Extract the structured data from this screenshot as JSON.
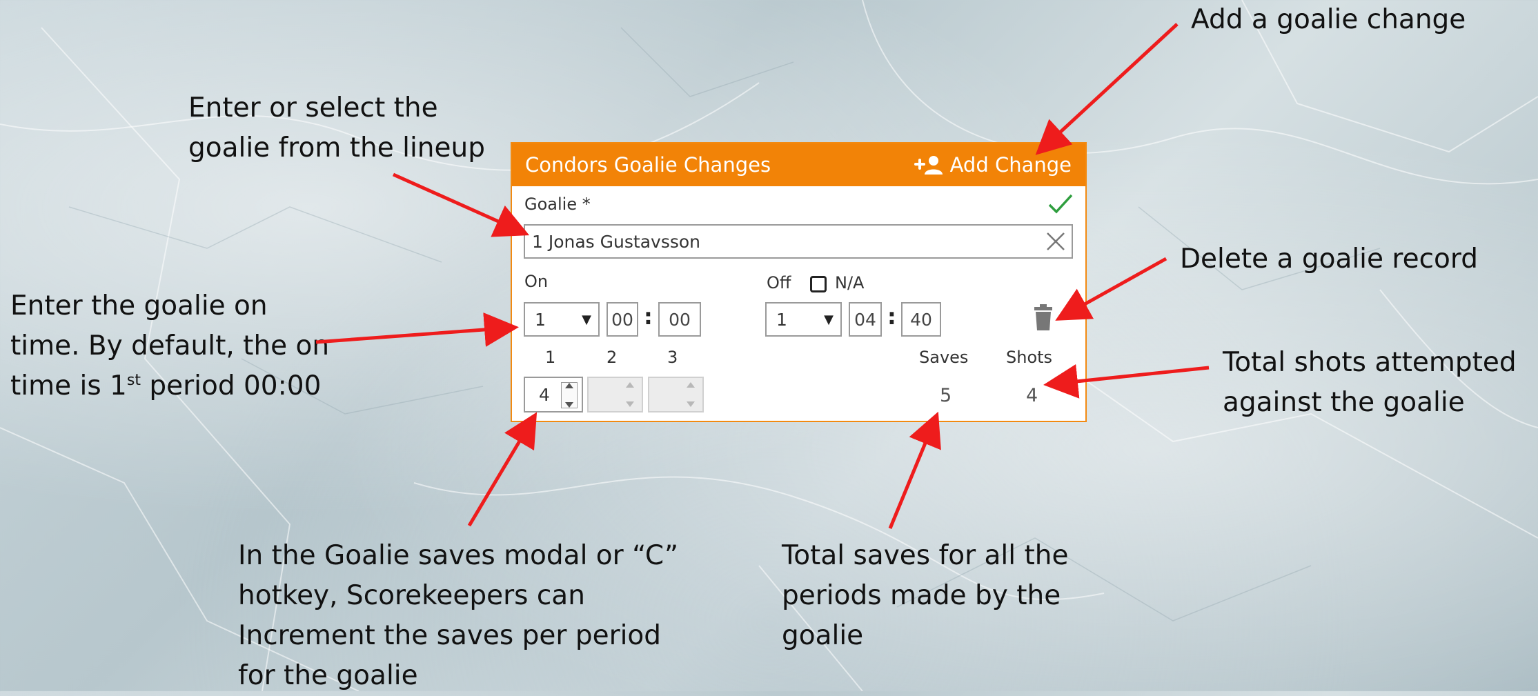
{
  "panel": {
    "title": "Condors Goalie Changes",
    "add_change_label": "Add Change",
    "goalie_label": "Goalie *",
    "goalie_value": "1 Jonas Gustavsson",
    "on_label": "On",
    "off_label": "Off",
    "na_label": "N/A",
    "on_period": "1",
    "on_min": "00",
    "on_sec": "00",
    "off_period": "1",
    "off_min": "04",
    "off_sec": "40",
    "period_headers": [
      "1",
      "2",
      "3"
    ],
    "period_saves": [
      "4",
      "",
      ""
    ],
    "saves_label": "Saves",
    "shots_label": "Shots",
    "saves_total": "5",
    "shots_total": "4",
    "accent_color": "#f28307",
    "valid_color": "#2e9e3e"
  },
  "annotations": {
    "add_change": "Add a goalie change",
    "select_goalie": [
      "Enter or select the",
      "goalie from the lineup"
    ],
    "delete_record": "Delete a goalie record",
    "on_time": [
      "Enter the goalie on",
      "time. By default, the on",
      "time is 1",
      "st",
      " period 00:00"
    ],
    "shots": [
      "Total shots attempted",
      "against the goalie"
    ],
    "saves_modal": [
      "In the Goalie saves modal or “C”",
      "hotkey, Scorekeepers can",
      "Increment the saves per period",
      "for the goalie"
    ],
    "saves_total": [
      "Total saves for all the",
      "periods made by the",
      "goalie"
    ],
    "arrow_color": "#ee1c1c"
  }
}
